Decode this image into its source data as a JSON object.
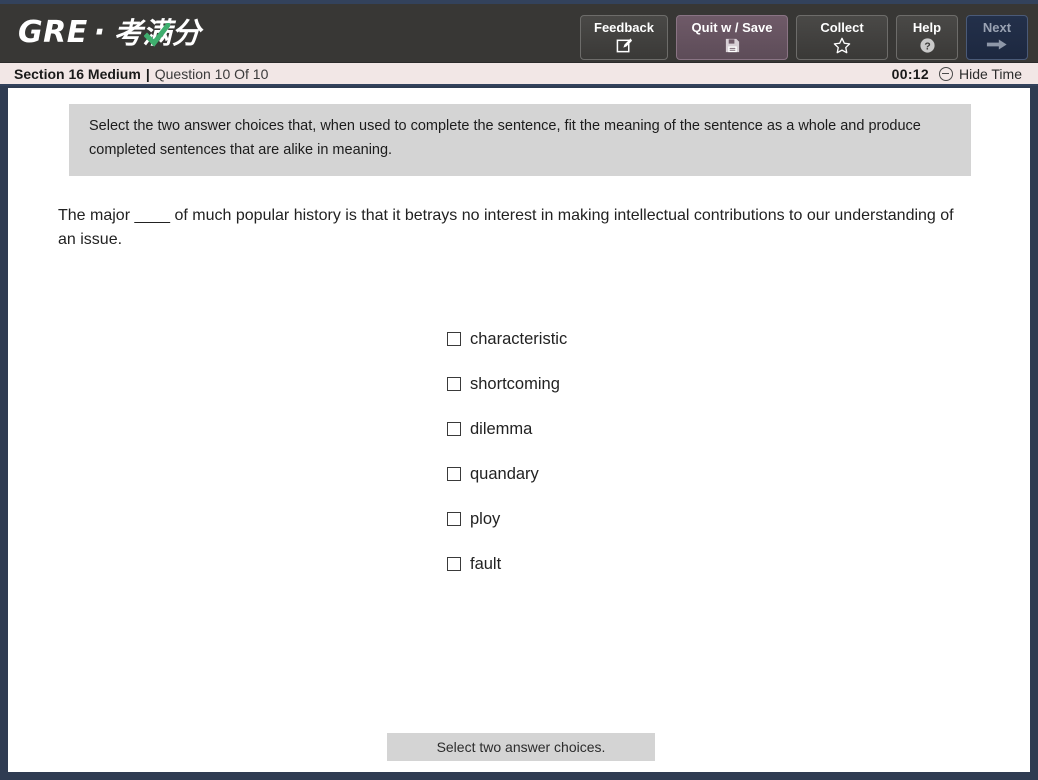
{
  "header": {
    "logo": {
      "brand": "GRE",
      "separator": "·",
      "brand_cn": "考满分",
      "check_icon": "green-check-icon",
      "check_color": "#3fae6e"
    },
    "buttons": [
      {
        "label": "Feedback",
        "icon": "edit-square-icon",
        "name": "feedback-button"
      },
      {
        "label": "Quit w / Save",
        "icon": "floppy-save-icon",
        "name": "quit-with-save-button"
      },
      {
        "label": "Collect",
        "icon": "star-outline-icon",
        "name": "collect-button"
      },
      {
        "label": "Help",
        "icon": "question-circle-icon",
        "name": "help-button"
      },
      {
        "label": "Next",
        "icon": "arrow-right-icon",
        "name": "next-button"
      }
    ]
  },
  "section_bar": {
    "section_name": "Section 16 Medium",
    "separator": "|",
    "question_counter": "Question 10 Of 10",
    "timer": "00:12",
    "hide_time_label": "Hide Time",
    "hide_time_icon": "minus-circle-icon",
    "background": "#f2e7e6"
  },
  "main": {
    "instructions": "Select the two answer choices that, when used to complete the sentence, fit the meaning of the sentence as a whole and produce completed sentences that are alike in meaning.",
    "question_stem": "The major ____ of much popular history is that it betrays no interest in making intellectual contributions to our understanding of an issue.",
    "choices": [
      {
        "label": "characteristic",
        "checked": false
      },
      {
        "label": "shortcoming",
        "checked": false
      },
      {
        "label": "dilemma",
        "checked": false
      },
      {
        "label": "quandary",
        "checked": false
      },
      {
        "label": "ploy",
        "checked": false
      },
      {
        "label": "fault",
        "checked": false
      }
    ],
    "footer_note": "Select two answer choices."
  }
}
